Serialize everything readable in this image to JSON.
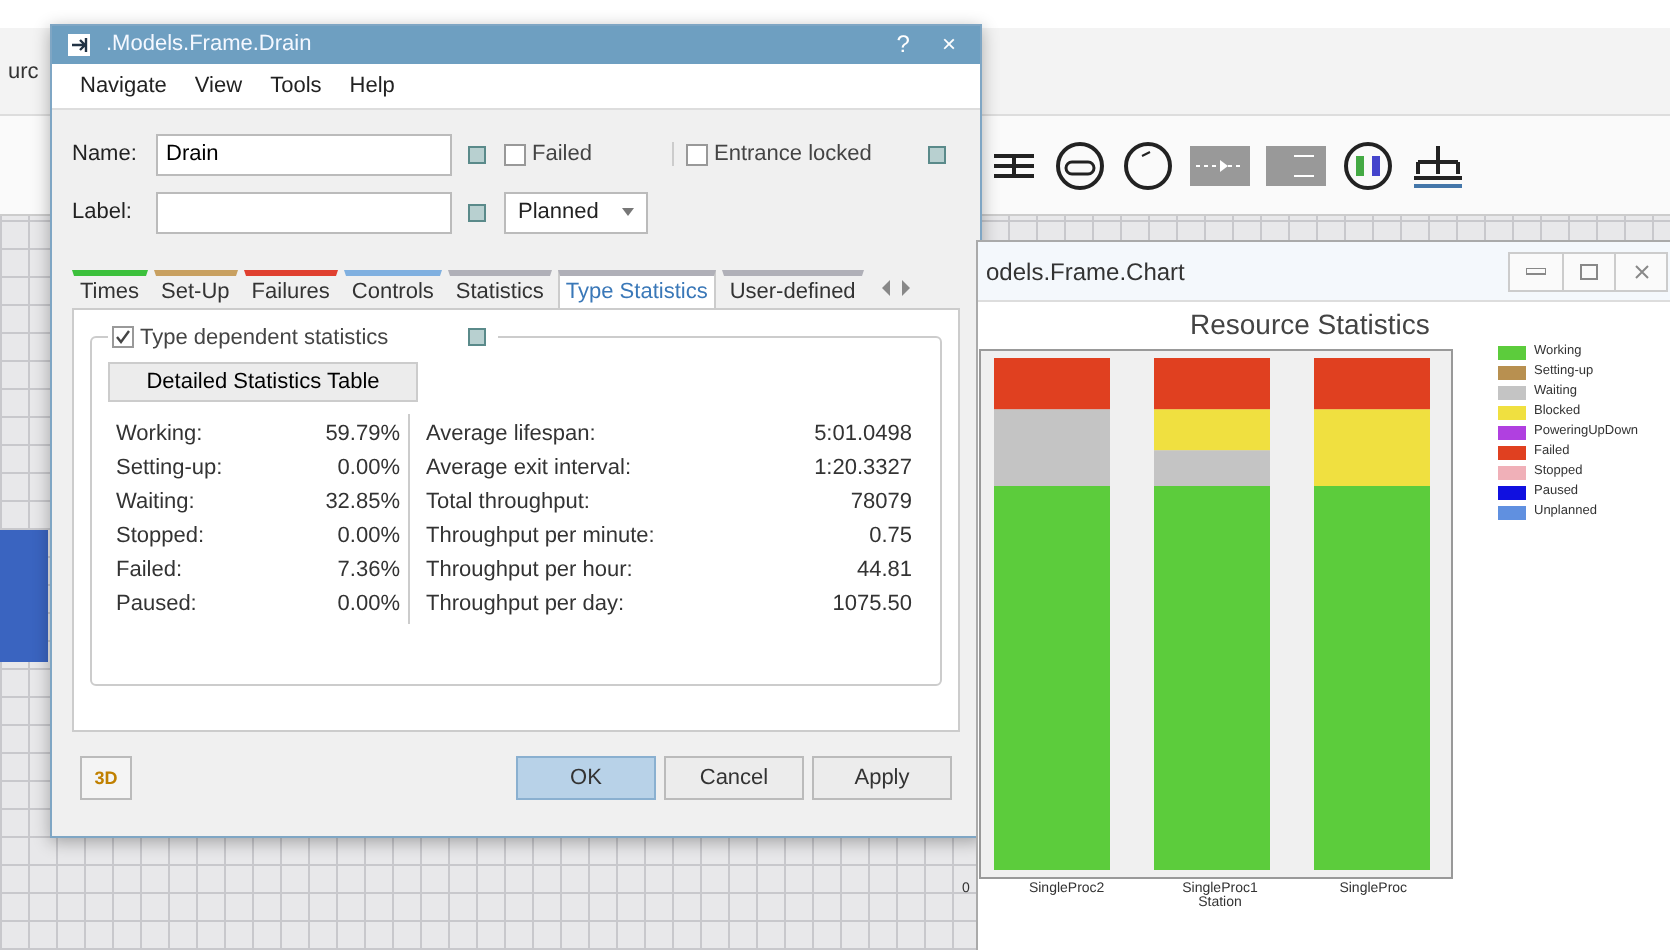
{
  "background": {
    "left_label": "urc"
  },
  "dialog": {
    "title": ".Models.Frame.Drain",
    "help": "?",
    "close": "×",
    "menu": [
      "Navigate",
      "View",
      "Tools",
      "Help"
    ],
    "name": {
      "label": "Name:",
      "value": "Drain"
    },
    "label_field": {
      "label": "Label:"
    },
    "failed": {
      "label": "Failed",
      "checked": false
    },
    "entrance_locked": {
      "label": "Entrance locked",
      "checked": false
    },
    "planned": {
      "value": "Planned"
    },
    "tabs": [
      {
        "label": "Times",
        "color": "#3cc03c",
        "selected": false
      },
      {
        "label": "Set-Up",
        "color": "#c8a060",
        "selected": false
      },
      {
        "label": "Failures",
        "color": "#e04030",
        "selected": false
      },
      {
        "label": "Controls",
        "color": "#80b0e0",
        "selected": false
      },
      {
        "label": "Statistics",
        "color": "#b0b0b8",
        "selected": false
      },
      {
        "label": "Type Statistics",
        "color": "#b0b0b8",
        "selected": true
      },
      {
        "label": "User-defined",
        "color": "#b0b0b8",
        "selected": false
      }
    ],
    "type_dependent": {
      "label": "Type dependent statistics",
      "checked": true
    },
    "table_button": "Detailed Statistics Table",
    "left_stats": [
      {
        "label": "Working:",
        "value": "59.79%"
      },
      {
        "label": "Setting-up:",
        "value": "0.00%"
      },
      {
        "label": "Waiting:",
        "value": "32.85%"
      },
      {
        "label": "Stopped:",
        "value": "0.00%"
      },
      {
        "label": "Failed:",
        "value": "7.36%"
      },
      {
        "label": "Paused:",
        "value": "0.00%"
      }
    ],
    "right_stats": [
      {
        "label": "Average lifespan:",
        "value": "5:01.0498"
      },
      {
        "label": "Average exit interval:",
        "value": "1:20.3327"
      },
      {
        "label": "Total throughput:",
        "value": "78079"
      },
      {
        "label": "Throughput per minute:",
        "value": "0.75"
      },
      {
        "label": "Throughput per hour:",
        "value": "44.81"
      },
      {
        "label": "Throughput per day:",
        "value": "1075.50"
      }
    ],
    "buttons": [
      {
        "label": "3D",
        "kind": "view"
      },
      {
        "label": "OK",
        "kind": "default"
      },
      {
        "label": "Cancel",
        "kind": "plain"
      },
      {
        "label": "Apply",
        "kind": "plain"
      }
    ]
  },
  "chart_window": {
    "title": "odels.Frame.Chart",
    "chart_title": "Resource Statistics",
    "y_tick": "0",
    "categories": [
      [
        "SingleProc2"
      ],
      [
        "SingleProc1",
        "Station"
      ],
      [
        "SingleProc"
      ]
    ],
    "legend": [
      {
        "label": "Working",
        "color": "#5ccc3c"
      },
      {
        "label": "Setting-up",
        "color": "#b89050"
      },
      {
        "label": "Waiting",
        "color": "#c4c4c4"
      },
      {
        "label": "Blocked",
        "color": "#f0e040"
      },
      {
        "label": "PoweringUpDown",
        "color": "#b040e0"
      },
      {
        "label": "Failed",
        "color": "#e04020"
      },
      {
        "label": "Stopped",
        "color": "#f0b0b8"
      },
      {
        "label": "Paused",
        "color": "#1010e0"
      },
      {
        "label": "Unplanned",
        "color": "#6090e0"
      }
    ]
  }
}
